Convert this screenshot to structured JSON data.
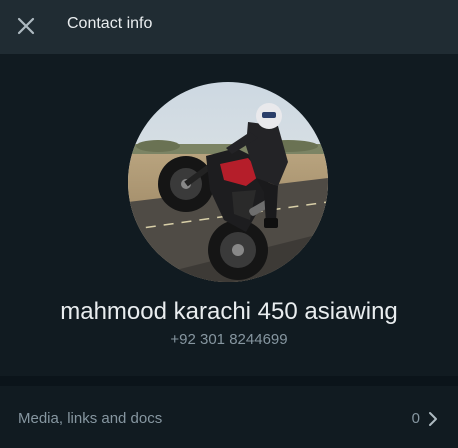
{
  "header": {
    "close_icon": "close-icon",
    "title": "Contact info"
  },
  "profile": {
    "avatar_icon": "profile-photo-motorcycle",
    "name": "mahmood karachi 450 asiawing",
    "phone": "+92 301 8244699"
  },
  "media": {
    "label": "Media, links and docs",
    "count": "0",
    "chevron_icon": "chevron-right-icon"
  },
  "colors": {
    "header_bg": "#202c33",
    "panel_bg": "#111b21",
    "separator_bg": "#0b141a",
    "primary_text": "#e9edef",
    "secondary_text": "#8696a0"
  }
}
